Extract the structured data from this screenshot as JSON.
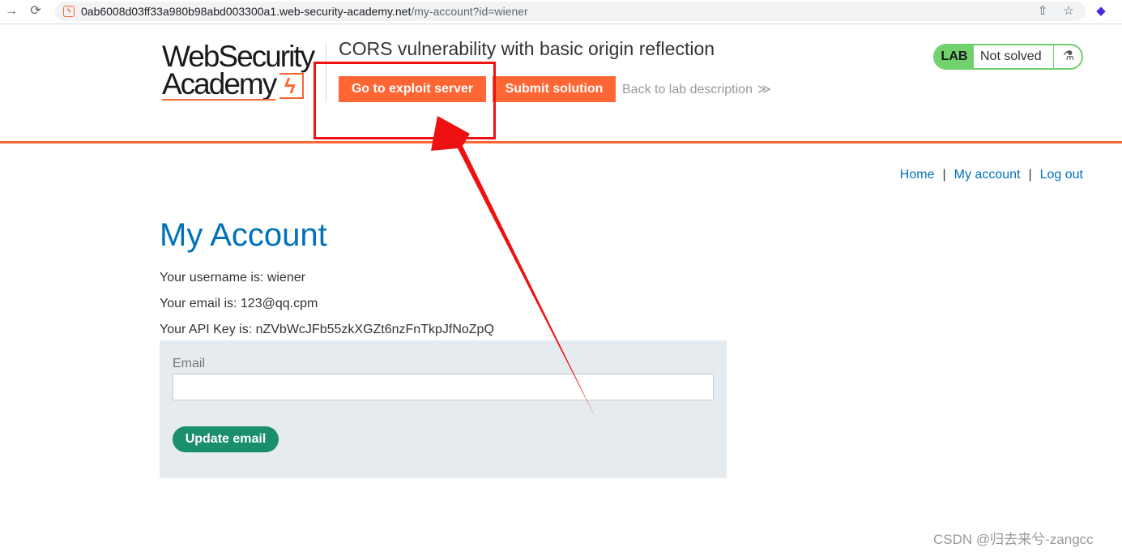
{
  "browser": {
    "back": "→",
    "reload": "⟳",
    "url_host": "0ab6008d03ff33a980b98abd003300a1.web-security-academy.net",
    "url_path": "/my-account?id=wiener",
    "share_icon": "share-icon",
    "star_icon": "bookmark-star-icon",
    "extension_icon": "extension-icon"
  },
  "header": {
    "logo_line1": "WebSecurity",
    "logo_line2": "Academy",
    "lab_title": "CORS vulnerability with basic origin reflection",
    "exploit_button": "Go to exploit server",
    "submit_button": "Submit solution",
    "back_link": "Back to lab description",
    "back_chevron": "≫",
    "lab_badge": "LAB",
    "lab_status": "Not solved",
    "brand_color": "#ff6633",
    "status_color": "#70d16d"
  },
  "topnav": {
    "home": "Home",
    "separator": "|",
    "my_account": "My account",
    "log_out": "Log out"
  },
  "account": {
    "title": "My Account",
    "username_line": "Your username is: wiener",
    "email_line": "Your email is: 123@qq.cpm",
    "apikey_line": "Your API Key is: nZVbWcJFb55zkXGZt6nzFnTkpJfNoZpQ",
    "email_label": "Email",
    "email_value": "",
    "update_button": "Update email",
    "link_color": "#0071bc",
    "button_color": "#1a8f6e"
  },
  "annotation": {
    "color": "#ee1111"
  },
  "watermark": "CSDN @归去来兮-zangcc"
}
